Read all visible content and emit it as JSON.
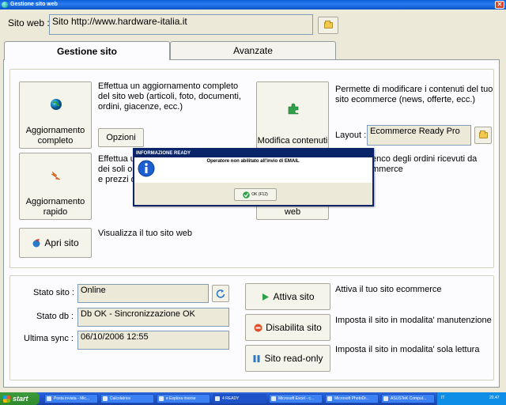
{
  "window": {
    "title": "Gestione sito web",
    "close_glyph": "✕"
  },
  "site": {
    "label": "Sito web :",
    "value": "Sito http://www.hardware-italia.it"
  },
  "tabs": [
    {
      "label": "Gestione sito"
    },
    {
      "label": "Avanzate"
    }
  ],
  "actions": {
    "update_full": {
      "label": "Aggiornamento completo",
      "description": "Effettua un aggiornamento completo del sito web (articoli, foto, documenti, ordini, giacenze, ecc.)",
      "options_label": "Opzioni"
    },
    "update_quick": {
      "label": "Aggiornamento rapido",
      "description_visible": "Effettua u\ndei soli or\ne prezzi d"
    },
    "open_site": {
      "label": "Apri sito",
      "description": "Visualizza il tuo sito web"
    },
    "edit_content": {
      "label": "Modifica contenuti",
      "description": "Permette di modificare i contenuti del tuo sito ecommerce (news, offerte, ecc.)"
    },
    "layout": {
      "label": "Layout :",
      "value": "Ecommerce Ready Pro"
    },
    "orders": {
      "label_visible": "web",
      "description_visible": "enco degli ordini ricevuti da\nmmerce"
    }
  },
  "status": {
    "site_state": {
      "label": "Stato sito :",
      "value": "Online"
    },
    "db_state": {
      "label": "Stato db :",
      "value": "Db OK - Sincronizzazione OK"
    },
    "last_sync": {
      "label": "Ultima sync :",
      "value": "06/10/2006 12:55"
    },
    "activate": {
      "label": "Attiva sito",
      "description": "Attiva il tuo sito ecommerce"
    },
    "disable": {
      "label": "Disabilita sito",
      "description": "Imposta il sito in modalita' manutenzione"
    },
    "readonly": {
      "label": "Sito read-only",
      "description": "Imposta il sito in modalita' sola lettura"
    }
  },
  "dialog": {
    "title": "INFORMAZIONE READY",
    "message": "Operatore non abilitato all'invio di EMAIL",
    "ok_label": "OK (F12)"
  },
  "taskbar": {
    "start_label": "start",
    "tasks": [
      {
        "label": "Posta inviata - Mic..."
      },
      {
        "label": "Calcolatrice"
      },
      {
        "label": "e Esplora risorse"
      },
      {
        "label": "4 READY"
      },
      {
        "label": "Microsoft Excel - c..."
      },
      {
        "label": "Microsoft PhotoDr..."
      },
      {
        "label": "ASUSTeK Comput..."
      }
    ],
    "tray_lang": "IT",
    "clock": "20.47"
  }
}
